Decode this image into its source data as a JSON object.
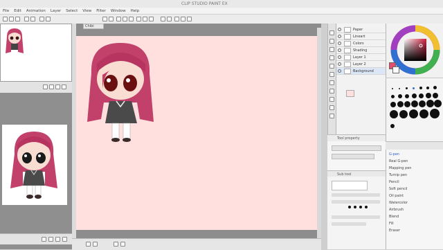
{
  "window": {
    "title": "CLIP STUDIO PAINT EX"
  },
  "menu": [
    "File",
    "Edit",
    "Animation",
    "Layer",
    "Select",
    "View",
    "Filter",
    "Window",
    "Help"
  ],
  "canvas_tab": "Chibi",
  "layers": [
    {
      "name": "Paper"
    },
    {
      "name": "Lineart"
    },
    {
      "name": "Colors"
    },
    {
      "name": "Shading"
    },
    {
      "name": "Layer 1"
    },
    {
      "name": "Layer 2"
    },
    {
      "name": "Background"
    }
  ],
  "tool_property": {
    "header": "Tool property"
  },
  "sub_tool": {
    "header": "Sub tool"
  },
  "brush_list": [
    "G-pen",
    "Real G-pen",
    "Mapping pen",
    "Turnip pen",
    "Pencil",
    "Soft pencil",
    "Oil paint",
    "Watercolor",
    "Airbrush",
    "Blend",
    "Fill",
    "Eraser"
  ],
  "colors": {
    "canvas": "#ffe0de",
    "hair": "#c2416a",
    "accent": "#e74c6f"
  }
}
